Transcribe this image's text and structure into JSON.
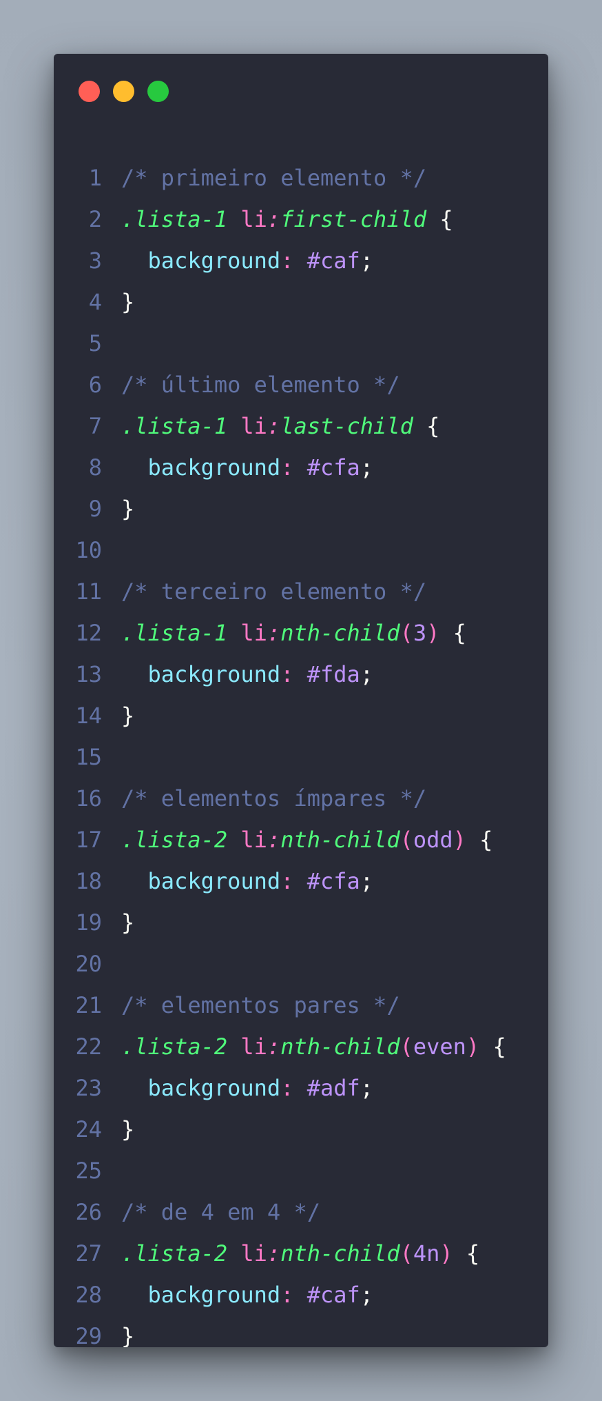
{
  "window": {
    "controls": [
      {
        "name": "close",
        "color": "#ff5f56"
      },
      {
        "name": "minimize",
        "color": "#ffbd2e"
      },
      {
        "name": "maximize",
        "color": "#27c93f"
      }
    ]
  },
  "code": {
    "lines": [
      {
        "n": "1",
        "kind": "comment",
        "text": "/* primeiro elemento */"
      },
      {
        "n": "2",
        "kind": "selector",
        "cls": ".lista-1",
        "tag": "li",
        "pseudo": "first-child",
        "arg": null
      },
      {
        "n": "3",
        "kind": "decl",
        "prop": "background",
        "value": "#caf"
      },
      {
        "n": "4",
        "kind": "close",
        "text": "}"
      },
      {
        "n": "5",
        "kind": "blank",
        "text": ""
      },
      {
        "n": "6",
        "kind": "comment",
        "text": "/* último elemento */"
      },
      {
        "n": "7",
        "kind": "selector",
        "cls": ".lista-1",
        "tag": "li",
        "pseudo": "last-child",
        "arg": null
      },
      {
        "n": "8",
        "kind": "decl",
        "prop": "background",
        "value": "#cfa"
      },
      {
        "n": "9",
        "kind": "close",
        "text": "}"
      },
      {
        "n": "10",
        "kind": "blank",
        "text": ""
      },
      {
        "n": "11",
        "kind": "comment",
        "text": "/* terceiro elemento */"
      },
      {
        "n": "12",
        "kind": "selector",
        "cls": ".lista-1",
        "tag": "li",
        "pseudo": "nth-child",
        "arg": "3"
      },
      {
        "n": "13",
        "kind": "decl",
        "prop": "background",
        "value": "#fda"
      },
      {
        "n": "14",
        "kind": "close",
        "text": "}"
      },
      {
        "n": "15",
        "kind": "blank",
        "text": ""
      },
      {
        "n": "16",
        "kind": "comment",
        "text": "/* elementos ímpares */"
      },
      {
        "n": "17",
        "kind": "selector",
        "cls": ".lista-2",
        "tag": "li",
        "pseudo": "nth-child",
        "arg": "odd"
      },
      {
        "n": "18",
        "kind": "decl",
        "prop": "background",
        "value": "#cfa"
      },
      {
        "n": "19",
        "kind": "close",
        "text": "}"
      },
      {
        "n": "20",
        "kind": "blank",
        "text": ""
      },
      {
        "n": "21",
        "kind": "comment",
        "text": "/* elementos pares */"
      },
      {
        "n": "22",
        "kind": "selector",
        "cls": ".lista-2",
        "tag": "li",
        "pseudo": "nth-child",
        "arg": "even"
      },
      {
        "n": "23",
        "kind": "decl",
        "prop": "background",
        "value": "#adf"
      },
      {
        "n": "24",
        "kind": "close",
        "text": "}"
      },
      {
        "n": "25",
        "kind": "blank",
        "text": ""
      },
      {
        "n": "26",
        "kind": "comment",
        "text": "/* de 4 em 4 */"
      },
      {
        "n": "27",
        "kind": "selector",
        "cls": ".lista-2",
        "tag": "li",
        "pseudo": "nth-child",
        "arg": "4n"
      },
      {
        "n": "28",
        "kind": "decl",
        "prop": "background",
        "value": "#caf"
      },
      {
        "n": "29",
        "kind": "close",
        "text": "}"
      }
    ]
  }
}
